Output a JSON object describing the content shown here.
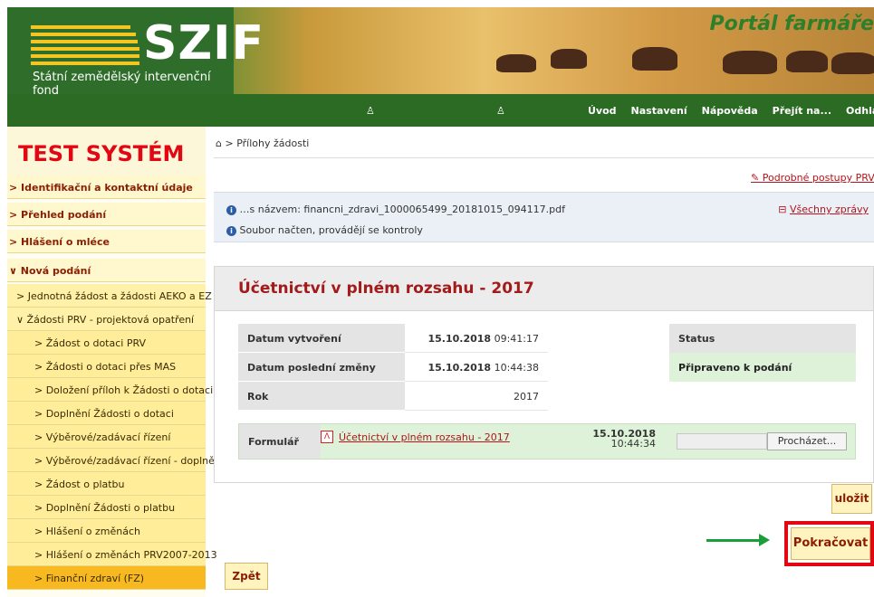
{
  "header": {
    "logo_text": "SZIF",
    "org_name": "Státní zemědělský intervenční fond",
    "portal_title": "Portál farmáře"
  },
  "nav": {
    "links": [
      "Úvod",
      "Nastavení",
      "Nápověda",
      "Přejít na...",
      "Odhlásit"
    ]
  },
  "sidebar": {
    "title": "TEST SYSTÉM",
    "items": [
      {
        "label": "> Identifikační a kontaktní údaje",
        "level": 0
      },
      {
        "label": "> Přehled podání",
        "level": 0
      },
      {
        "label": "> Hlášení o mléce",
        "level": 0
      },
      {
        "label": "∨ Nová podání",
        "level": 0
      },
      {
        "label": "> Jednotná žádost a žádosti AEKO a EZ",
        "level": 1
      },
      {
        "label": "∨ Žádosti PRV - projektová opatření",
        "level": 1
      },
      {
        "label": "> Žádost o dotaci PRV",
        "level": 2
      },
      {
        "label": "> Žádosti o dotaci přes MAS",
        "level": 2
      },
      {
        "label": "> Doložení příloh k Žádosti o dotaci",
        "level": 2
      },
      {
        "label": "> Doplnění Žádosti o dotaci",
        "level": 2
      },
      {
        "label": "> Výběrové/zadávací řízení",
        "level": 2
      },
      {
        "label": "> Výběrové/zadávací řízení - doplnění",
        "level": 2
      },
      {
        "label": "> Žádost o platbu",
        "level": 2
      },
      {
        "label": "> Doplnění Žádosti o platbu",
        "level": 2
      },
      {
        "label": "> Hlášení o změnách",
        "level": 2
      },
      {
        "label": "> Hlášení o změnách PRV2007-2013",
        "level": 2
      },
      {
        "label": "> Finanční zdraví (FZ)",
        "level": 2,
        "active": true
      }
    ]
  },
  "breadcrumb": "> Přílohy žádosti",
  "help_link": "Podrobné postupy PRV",
  "messages": {
    "msg1": "…s názvem: financni_zdravi_1000065499_20181015_094117.pdf",
    "msg2": "Soubor načten, provádějí se kontroly",
    "all_messages": "Všechny zprávy"
  },
  "panel": {
    "title": "Účetnictví v plném rozsahu - 2017",
    "created_label": "Datum vytvoření",
    "created_date": "15.10.2018",
    "created_time": "09:41:17",
    "modified_label": "Datum poslední změny",
    "modified_date": "15.10.2018",
    "modified_time": "10:44:38",
    "year_label": "Rok",
    "year_value": "2017",
    "status_label": "Status",
    "status_value": "Připraveno k podání",
    "form_label": "Formulář",
    "form_link": "Účetnictví v plném rozsahu - 2017",
    "form_date": "15.10.2018",
    "form_time": "10:44:34",
    "browse_label": "Procházet..."
  },
  "buttons": {
    "save": "uložit",
    "continue": "Pokračovat",
    "back": "Zpět"
  },
  "colors": {
    "nav_green": "#2b6b24",
    "accent_red": "#e30613",
    "sidebar_active": "#f8b820",
    "status_green": "#ddf2d8"
  }
}
